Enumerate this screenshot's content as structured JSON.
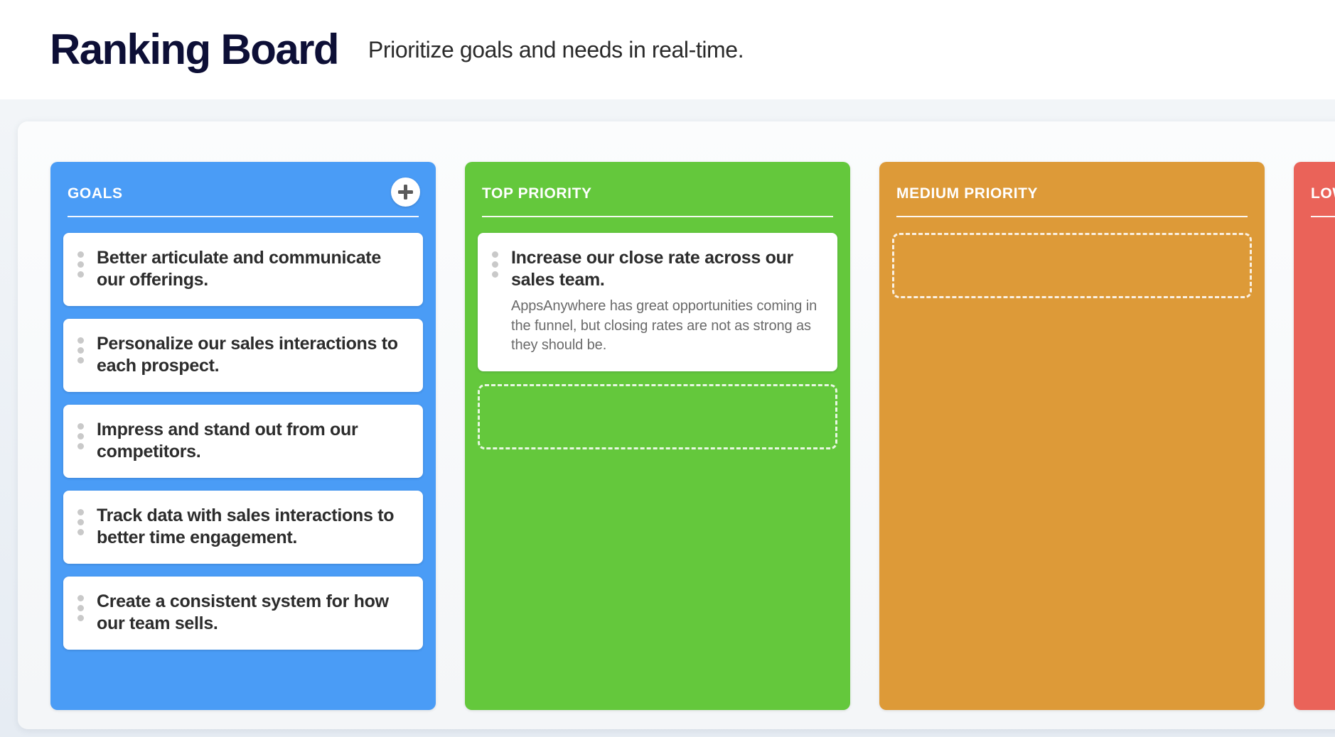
{
  "header": {
    "title": "Ranking Board",
    "subtitle": "Prioritize goals and needs in real-time."
  },
  "icons": {
    "add": "plus-icon",
    "drag": "drag-handle-dots-icon"
  },
  "colors": {
    "goals": "#4a9cf6",
    "top_priority": "#64c83c",
    "medium_priority": "#dd9a38",
    "low_priority": "#ea6359",
    "title_text": "#0d0f36",
    "card_title_text": "#2c2c2c",
    "card_desc_text": "#6a6a6a",
    "board_background": "#f4f6f8"
  },
  "board": {
    "columns": [
      {
        "id": "goals",
        "title": "GOALS",
        "color": "#4a9cf6",
        "has_add_button": true,
        "add_button_label": "+",
        "has_drop_zone": false,
        "cards": [
          {
            "title": "Better articulate and communicate our offerings.",
            "desc": ""
          },
          {
            "title": "Personalize our sales interactions to each prospect.",
            "desc": ""
          },
          {
            "title": "Impress and stand out from our competitors.",
            "desc": ""
          },
          {
            "title": "Track data with sales interactions to better time engagement.",
            "desc": ""
          },
          {
            "title": "Create a consistent system for how our team sells.",
            "desc": ""
          }
        ]
      },
      {
        "id": "top-priority",
        "title": "TOP PRIORITY",
        "color": "#64c83c",
        "has_add_button": false,
        "add_button_label": "",
        "has_drop_zone": true,
        "cards": [
          {
            "title": "Increase our close rate across our sales team.",
            "desc": "AppsAnywhere has great opportunities coming in the funnel, but closing rates are not as strong as they should be."
          }
        ]
      },
      {
        "id": "medium-priority",
        "title": "MEDIUM PRIORITY",
        "color": "#dd9a38",
        "has_add_button": false,
        "add_button_label": "",
        "has_drop_zone": true,
        "cards": []
      },
      {
        "id": "low-priority",
        "title": "LOW PRIORITY",
        "color": "#ea6359",
        "has_add_button": false,
        "add_button_label": "",
        "has_drop_zone": false,
        "cards": []
      }
    ]
  }
}
